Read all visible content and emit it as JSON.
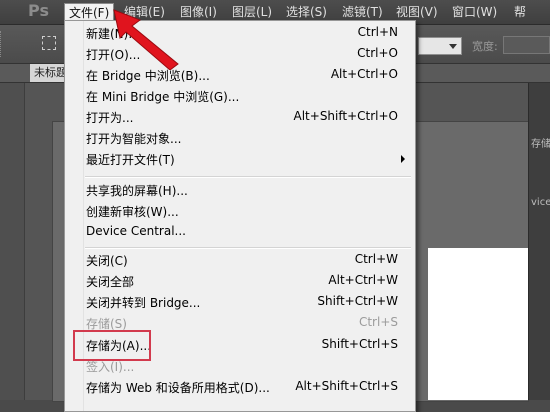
{
  "app": {
    "logo": "Ps"
  },
  "menubar": {
    "items": [
      {
        "label": "文件(F)"
      },
      {
        "label": "编辑(E)"
      },
      {
        "label": "图像(I)"
      },
      {
        "label": "图层(L)"
      },
      {
        "label": "选择(S)"
      },
      {
        "label": "滤镜(T)"
      },
      {
        "label": "视图(V)"
      },
      {
        "label": "窗口(W)"
      },
      {
        "label": "帮"
      }
    ]
  },
  "options_bar": {
    "width_label": "宽度:"
  },
  "document_tab": {
    "label": "未标题"
  },
  "right_dock": {
    "snippet_1": "存储",
    "snippet_2": "vice"
  },
  "file_menu": {
    "items": [
      {
        "label": "新建(N)...",
        "shortcut": "Ctrl+N"
      },
      {
        "label": "打开(O)...",
        "shortcut": "Ctrl+O"
      },
      {
        "label": "在 Bridge 中浏览(B)...",
        "shortcut": "Alt+Ctrl+O"
      },
      {
        "label": "在 Mini Bridge 中浏览(G)...",
        "shortcut": ""
      },
      {
        "label": "打开为...",
        "shortcut": "Alt+Shift+Ctrl+O"
      },
      {
        "label": "打开为智能对象...",
        "shortcut": ""
      },
      {
        "label": "最近打开文件(T)",
        "shortcut": ""
      },
      {
        "label": "共享我的屏幕(H)...",
        "shortcut": ""
      },
      {
        "label": "创建新审核(W)...",
        "shortcut": ""
      },
      {
        "label": "Device Central...",
        "shortcut": ""
      },
      {
        "label": "关闭(C)",
        "shortcut": "Ctrl+W"
      },
      {
        "label": "关闭全部",
        "shortcut": "Alt+Ctrl+W"
      },
      {
        "label": "关闭并转到 Bridge...",
        "shortcut": "Shift+Ctrl+W"
      },
      {
        "label": "存储(S)",
        "shortcut": "Ctrl+S"
      },
      {
        "label": "存储为(A)...",
        "shortcut": "Shift+Ctrl+S"
      },
      {
        "label": "签入(I)...",
        "shortcut": ""
      },
      {
        "label": "存储为 Web 和设备所用格式(D)...",
        "shortcut": "Alt+Shift+Ctrl+S"
      }
    ]
  },
  "colors": {
    "highlight_box": "#d23a4d",
    "pointer_arrow": "#e0141e"
  }
}
